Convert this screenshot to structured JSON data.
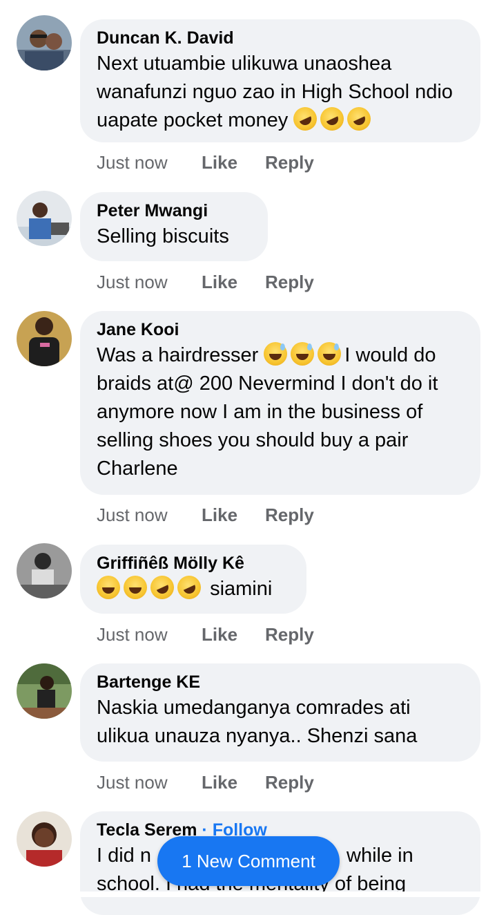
{
  "comments": [
    {
      "name": "Duncan K. David",
      "text": "Next utuambie ulikuwa unaoshea wanafunzi nguo zao in High School ndio uapate pocket money",
      "emoji": [
        "rolling-on-floor-laughing",
        "rolling-on-floor-laughing",
        "rolling-on-floor-laughing"
      ],
      "time": "Just now",
      "like": "Like",
      "reply": "Reply"
    },
    {
      "name": "Peter Mwangi",
      "text": "Selling biscuits",
      "time": "Just now",
      "like": "Like",
      "reply": "Reply"
    },
    {
      "name": "Jane Kooi",
      "text_before": "Was a hairdresser",
      "emoji": [
        "grinning-sweat",
        "grinning-sweat",
        "grinning-sweat"
      ],
      "text_after": "I would do braids at@ 200 Nevermind I don't do it anymore now I am in the business of selling shoes you should buy a pair Charlene",
      "time": "Just now",
      "like": "Like",
      "reply": "Reply"
    },
    {
      "name": "Griffiñêß Mölly Kê",
      "emoji": [
        "joy",
        "joy",
        "rolling-on-floor-laughing",
        "rolling-on-floor-laughing"
      ],
      "text": "siamini",
      "time": "Just now",
      "like": "Like",
      "reply": "Reply"
    },
    {
      "name": "Bartenge KE",
      "text": "Naskia umedanganya comrades  ati ulikua unauza nyanya.. Shenzi  sana",
      "time": "Just now",
      "like": "Like",
      "reply": "Reply"
    },
    {
      "name": "Tecla Serem",
      "follow": "· Follow",
      "text_line1_left": "I did n",
      "text_line1_right": "while in",
      "text_line2": "school.  I had the mentality of being"
    }
  ],
  "new_comment_button": "1 New Comment",
  "colors": {
    "accent": "#1877f2",
    "bubble": "#f0f2f5",
    "meta": "#65676b"
  }
}
